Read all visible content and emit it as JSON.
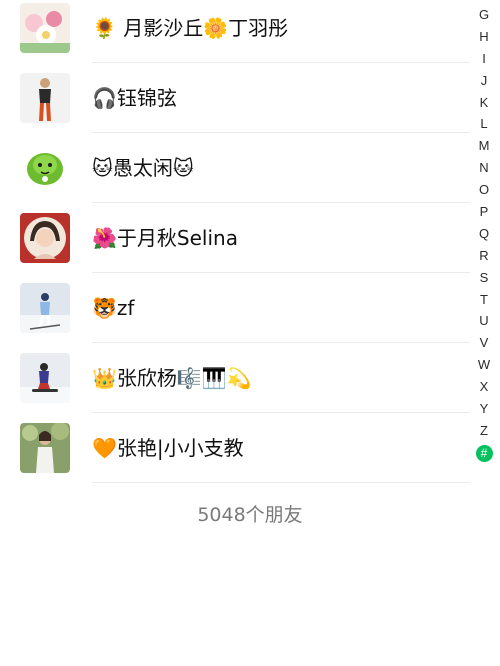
{
  "contacts": [
    {
      "name": "🌻 月影沙丘🌼丁羽彤",
      "avatar": "flowers-photo"
    },
    {
      "name": "🎧钰锦弦",
      "avatar": "woman-standing-photo"
    },
    {
      "name": "🐱愚太闲🐱",
      "avatar": "green-cabbage-cartoon"
    },
    {
      "name": "🌺于月秋Selina",
      "avatar": "woman-portrait-photo"
    },
    {
      "name": "🐯zf",
      "avatar": "skier-photo"
    },
    {
      "name": "👑张欣杨🎼🎹💫",
      "avatar": "snowboarder-photo"
    },
    {
      "name": "🧡张艳|小小支教",
      "avatar": "woman-outdoor-photo"
    }
  ],
  "footer": {
    "count_label": "5048个朋友"
  },
  "index_bar": {
    "letters": [
      "G",
      "H",
      "I",
      "J",
      "K",
      "L",
      "M",
      "N",
      "O",
      "P",
      "Q",
      "R",
      "S",
      "T",
      "U",
      "V",
      "W",
      "X",
      "Y",
      "Z",
      "#"
    ],
    "active": "#",
    "active_color": "#07c160"
  }
}
